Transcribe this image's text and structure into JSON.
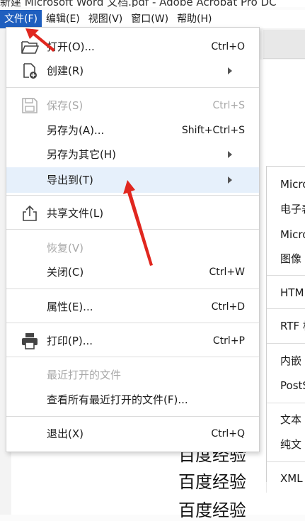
{
  "window": {
    "title": "新建 Microsoft Word 文档.pdf - Adobe Acrobat Pro DC"
  },
  "menubar": [
    {
      "label": "文件(F)",
      "active": true
    },
    {
      "label": "编辑(E)"
    },
    {
      "label": "视图(V)"
    },
    {
      "label": "窗口(W)"
    },
    {
      "label": "帮助(H)"
    }
  ],
  "file_menu": {
    "items": {
      "open": {
        "label": "打开(O)...",
        "shortcut": "Ctrl+O",
        "icon": "folder-open-icon"
      },
      "create": {
        "label": "创建(R)",
        "icon": "create-pdf-icon",
        "submenu": true
      },
      "save": {
        "label": "保存(S)",
        "shortcut": "Ctrl+S",
        "icon": "save-icon",
        "disabled": true
      },
      "save_as": {
        "label": "另存为(A)...",
        "shortcut": "Shift+Ctrl+S"
      },
      "save_as_other": {
        "label": "另存为其它(H)",
        "submenu": true
      },
      "export_to": {
        "label": "导出到(T)",
        "submenu": true,
        "highlighted": true
      },
      "share": {
        "label": "共享文件(L)",
        "icon": "share-icon"
      },
      "revert": {
        "label": "恢复(V)",
        "disabled": true
      },
      "close": {
        "label": "关闭(C)",
        "shortcut": "Ctrl+W"
      },
      "properties": {
        "label": "属性(E)...",
        "shortcut": "Ctrl+D"
      },
      "print": {
        "label": "打印(P)...",
        "shortcut": "Ctrl+P",
        "icon": "printer-icon"
      },
      "recent_header": {
        "label": "最近打开的文件",
        "disabled": true
      },
      "view_recent": {
        "label": "查看所有最近打开的文件(F)..."
      },
      "exit": {
        "label": "退出(X)",
        "shortcut": "Ctrl+Q"
      }
    }
  },
  "export_submenu": {
    "items": [
      "Micro",
      "电子表",
      "Micro",
      "图像",
      "HTM",
      "RTF 格",
      "内嵌",
      "PostS",
      "文本",
      "纯文",
      "XML"
    ]
  },
  "document": {
    "lines": [
      "百度经验",
      "百度经验",
      "百度经验"
    ]
  },
  "colors": {
    "menubar_active": "#1f5fbf",
    "highlight": "#e6f0fb",
    "annotation_arrow": "#e0271f"
  }
}
